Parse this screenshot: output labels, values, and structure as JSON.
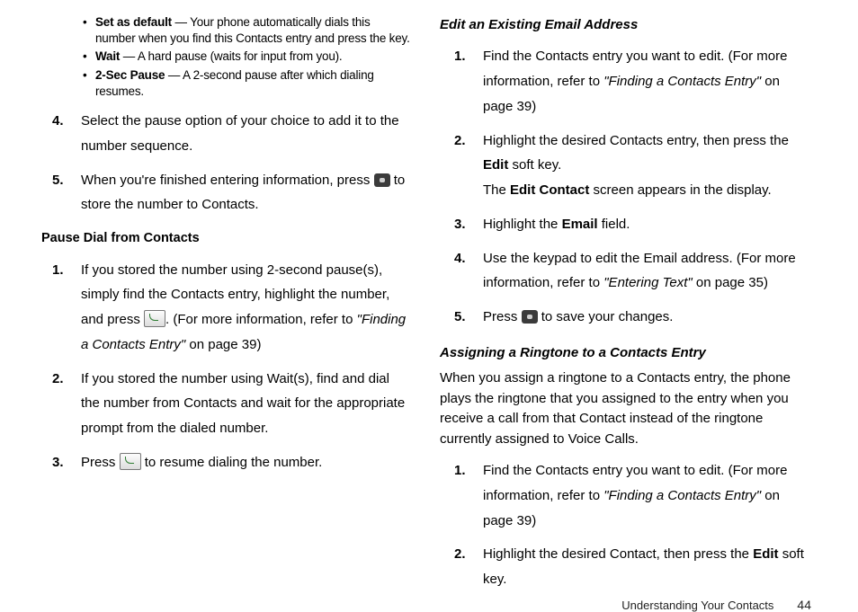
{
  "left": {
    "bullets": [
      {
        "term": "Set as default",
        "desc": " — Your phone automatically dials this number when you find this Contacts entry and press the key."
      },
      {
        "term": "Wait",
        "desc": " — A hard pause (waits for input from you)."
      },
      {
        "term": "2-Sec Pause",
        "desc": " — A 2-second pause after which dialing resumes."
      }
    ],
    "step4": {
      "num": "4.",
      "text": "Select the pause option of your choice to add it to the number sequence."
    },
    "step5": {
      "num": "5.",
      "pre": "When you're finished entering information, press ",
      "post": " to store the number to Contacts."
    },
    "h3": "Pause Dial from Contacts",
    "p1": {
      "num": "1.",
      "pre": "If you stored the number using 2-second pause(s), simply find the Contacts entry, highlight the number, and press ",
      "mid": ". (For more information, refer to ",
      "ref": "\"Finding a Contacts Entry\"",
      "post": " on page 39)"
    },
    "p2": {
      "num": "2.",
      "text": "If you stored the number using Wait(s), find and dial the number from Contacts and wait for the appropriate prompt from the dialed number."
    },
    "p3": {
      "num": "3.",
      "pre": "Press ",
      "post": " to resume dialing the number."
    }
  },
  "right": {
    "h2a": "Edit an Existing Email Address",
    "s1": {
      "num": "1.",
      "pre": "Find the Contacts entry you want to edit. (For more information, refer to ",
      "ref": "\"Finding a Contacts Entry\"",
      "post": " on page 39)"
    },
    "s2": {
      "num": "2.",
      "pre": "Highlight the desired Contacts entry, then press the ",
      "bold": "Edit",
      "post": " soft key.",
      "line2a": "The ",
      "line2b": "Edit Contact",
      "line2c": " screen appears in the display."
    },
    "s3": {
      "num": "3.",
      "pre": "Highlight the ",
      "bold": "Email",
      "post": " field."
    },
    "s4": {
      "num": "4.",
      "pre": "Use the keypad to edit the Email address. (For more information, refer to ",
      "ref": "\"Entering Text\"",
      "post": " on page 35)"
    },
    "s5": {
      "num": "5.",
      "pre": "Press ",
      "post": " to save your changes."
    },
    "h2b": "Assigning a Ringtone to a Contacts Entry",
    "intro": "When you assign a ringtone to a Contacts entry, the phone plays the ringtone that you assigned to the entry when you receive a call from that Contact instead of the ringtone currently assigned to Voice Calls.",
    "r1": {
      "num": "1.",
      "pre": "Find the Contacts entry you want to edit. (For more information, refer to ",
      "ref": "\"Finding a Contacts Entry\"",
      "post": " on page 39)"
    },
    "r2": {
      "num": "2.",
      "pre": "Highlight the desired Contact, then press the ",
      "bold": "Edit",
      "post": " soft key."
    }
  },
  "footer": {
    "section": "Understanding Your Contacts",
    "page": "44"
  }
}
